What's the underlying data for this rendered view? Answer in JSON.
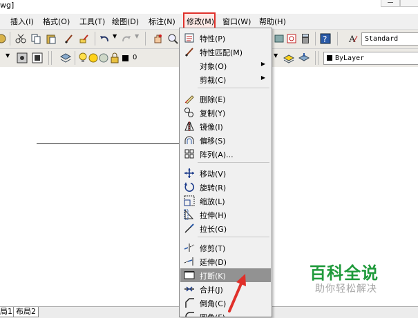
{
  "window": {
    "title": "wg]"
  },
  "menubar": {
    "items": [
      "插入(I)",
      "格式(O)",
      "工具(T)",
      "绘图(D)",
      "标注(N)",
      "修改(M)",
      "窗口(W)",
      "帮助(H)"
    ]
  },
  "toolbar": {
    "text_style": "Standard",
    "layer_value": "0",
    "color_value": "ByLayer"
  },
  "modify_menu": {
    "items": [
      {
        "label": "特性(P)",
        "icon": "properties-icon"
      },
      {
        "label": "特性匹配(M)",
        "icon": "match-properties-icon"
      },
      {
        "label": "对象(O)",
        "submenu": true
      },
      {
        "label": "剪裁(C)",
        "submenu": true
      },
      {
        "label": "删除(E)",
        "icon": "erase-icon"
      },
      {
        "label": "复制(Y)",
        "icon": "copy-icon"
      },
      {
        "label": "镜像(I)",
        "icon": "mirror-icon"
      },
      {
        "label": "偏移(S)",
        "icon": "offset-icon"
      },
      {
        "label": "阵列(A)...",
        "icon": "array-icon"
      },
      {
        "label": "移动(V)",
        "icon": "move-icon"
      },
      {
        "label": "旋转(R)",
        "icon": "rotate-icon"
      },
      {
        "label": "缩放(L)",
        "icon": "scale-icon"
      },
      {
        "label": "拉伸(H)",
        "icon": "stretch-icon"
      },
      {
        "label": "拉长(G)",
        "icon": "lengthen-icon"
      },
      {
        "label": "修剪(T)",
        "icon": "trim-icon"
      },
      {
        "label": "延伸(D)",
        "icon": "extend-icon"
      },
      {
        "label": "打断(K)",
        "icon": "break-icon",
        "highlighted": true
      },
      {
        "label": "合并(J)",
        "icon": "join-icon"
      },
      {
        "label": "倒角(C)",
        "icon": "chamfer-icon"
      },
      {
        "label": "圆角(F)",
        "icon": "fillet-icon"
      }
    ]
  },
  "layout_tabs": [
    "局1",
    "布局2"
  ],
  "watermark": {
    "title": "百科全说",
    "subtitle": "助你轻松解决"
  },
  "colors": {
    "highlight": "#929292",
    "annotation_red": "#e0302a",
    "watermark_green": "#1f9a3b"
  }
}
